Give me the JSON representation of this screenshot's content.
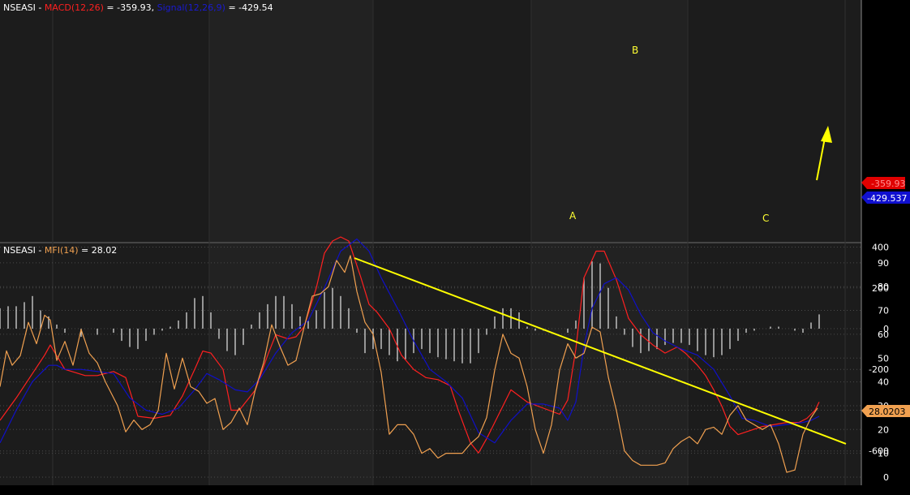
{
  "macd_panel": {
    "symbol": "NSEASI",
    "sep1": " - ",
    "macd_label": "MACD(12,26)",
    "macd_eq": " = -359.93, ",
    "signal_label": "Signal(12,26,9)",
    "signal_eq": " = -429.54",
    "badge_macd": "-359.93",
    "badge_signal": "-429.537",
    "annotations": [
      "A",
      "B",
      "C"
    ]
  },
  "mfi_panel": {
    "symbol": "NSEASI",
    "sep1": " - ",
    "mfi_label": "MFI(14)",
    "mfi_eq": " = 28.02",
    "badge_mfi": "28.0203"
  },
  "colors": {
    "background": "#000000",
    "panel": "#1c1c1c",
    "macd": "#ff2020",
    "signal": "#1010c8",
    "histogram": "#e6e6e6",
    "mfi": "#f0a050",
    "trendline": "#ffff00",
    "arrow": "#ffff00"
  },
  "chart_data": [
    {
      "type": "line",
      "ylim": [
        -650,
        450
      ],
      "yticks": [
        400,
        200,
        0,
        -200,
        -400,
        -600
      ],
      "xlim": [
        0,
        1060
      ],
      "series": [
        {
          "name": "MACD(12,26)",
          "color": "#ff2020",
          "x": [
            0,
            20,
            40,
            55,
            62,
            80,
            105,
            120,
            140,
            155,
            170,
            190,
            210,
            225,
            240,
            250,
            260,
            275,
            285,
            295,
            315,
            330,
            340,
            355,
            365,
            375,
            390,
            400,
            410,
            420,
            430,
            445,
            455,
            465,
            480,
            495,
            510,
            525,
            540,
            555,
            565,
            580,
            590,
            600,
            615,
            630,
            650,
            670,
            690,
            700,
            710,
            720,
            735,
            745,
            760,
            775,
            790,
            805,
            820,
            835,
            845,
            860,
            870,
            880,
            890,
            900,
            910,
            925,
            940,
            955,
            970,
            985,
            995,
            1000,
            1005,
            1010
          ],
          "y": [
            -450,
            -340,
            -220,
            -130,
            -80,
            -200,
            -230,
            -230,
            -210,
            -240,
            -430,
            -440,
            -425,
            -330,
            -200,
            -110,
            -120,
            -200,
            -400,
            -400,
            -300,
            -130,
            -30,
            -50,
            -40,
            10,
            200,
            370,
            430,
            450,
            430,
            250,
            120,
            80,
            0,
            -130,
            -200,
            -240,
            -250,
            -280,
            -400,
            -560,
            -610,
            -540,
            -420,
            -300,
            -360,
            -390,
            -420,
            -350,
            -100,
            250,
            380,
            380,
            240,
            50,
            -30,
            -80,
            -120,
            -90,
            -120,
            -180,
            -230,
            -300,
            -380,
            -480,
            -520,
            -500,
            -480,
            -470,
            -460,
            -460,
            -440,
            -420,
            -400,
            -360
          ]
        },
        {
          "name": "Signal(12,26,9)",
          "color": "#1010c8",
          "x": [
            0,
            20,
            40,
            60,
            70,
            80,
            100,
            120,
            140,
            160,
            180,
            200,
            220,
            240,
            255,
            270,
            290,
            305,
            320,
            340,
            360,
            380,
            400,
            420,
            440,
            455,
            470,
            490,
            510,
            530,
            550,
            570,
            590,
            610,
            630,
            650,
            670,
            690,
            700,
            710,
            720,
            730,
            745,
            760,
            775,
            790,
            805,
            820,
            840,
            860,
            880,
            900,
            915,
            930,
            950,
            970,
            990,
            1000,
            1010
          ],
          "y": [
            -560,
            -400,
            -260,
            -180,
            -180,
            -200,
            -200,
            -210,
            -220,
            -340,
            -400,
            -420,
            -390,
            -300,
            -220,
            -250,
            -300,
            -310,
            -250,
            -120,
            -20,
            40,
            200,
            380,
            440,
            380,
            250,
            100,
            -60,
            -200,
            -260,
            -340,
            -510,
            -560,
            -450,
            -370,
            -370,
            -390,
            -450,
            -360,
            -90,
            100,
            220,
            250,
            190,
            70,
            -20,
            -60,
            -100,
            -130,
            -200,
            -330,
            -440,
            -450,
            -480,
            -470,
            -460,
            -450,
            -430
          ]
        },
        {
          "name": "Histogram",
          "type": "bar",
          "color": "#e6e6e6",
          "x": [
            0,
            10,
            20,
            30,
            40,
            50,
            60,
            70,
            80,
            100,
            120,
            140,
            150,
            160,
            170,
            180,
            190,
            200,
            210,
            220,
            230,
            240,
            250,
            260,
            270,
            280,
            290,
            300,
            310,
            320,
            330,
            340,
            350,
            360,
            370,
            380,
            390,
            400,
            410,
            420,
            430,
            440,
            450,
            460,
            470,
            480,
            490,
            500,
            510,
            520,
            530,
            540,
            550,
            560,
            570,
            580,
            590,
            600,
            610,
            620,
            630,
            640,
            650,
            660,
            670,
            680,
            690,
            700,
            710,
            720,
            730,
            740,
            750,
            760,
            770,
            780,
            790,
            800,
            810,
            820,
            830,
            840,
            850,
            860,
            870,
            880,
            890,
            900,
            910,
            920,
            930,
            940,
            950,
            960,
            970,
            980,
            990,
            1000,
            1010
          ],
          "y": [
            100,
            110,
            110,
            130,
            160,
            90,
            60,
            20,
            -20,
            -40,
            -30,
            -20,
            -60,
            -90,
            -100,
            -60,
            -30,
            -10,
            10,
            40,
            80,
            150,
            160,
            80,
            -50,
            -110,
            -130,
            -80,
            20,
            80,
            120,
            160,
            160,
            120,
            60,
            40,
            90,
            180,
            200,
            160,
            100,
            -20,
            -120,
            -100,
            -100,
            -130,
            -160,
            -150,
            -120,
            -100,
            -120,
            -140,
            -150,
            -160,
            -170,
            -170,
            -120,
            -30,
            60,
            100,
            100,
            80,
            10,
            -10,
            -10,
            0,
            0,
            -20,
            40,
            250,
            330,
            320,
            200,
            60,
            -30,
            -90,
            -120,
            -110,
            -100,
            -80,
            -70,
            -70,
            -80,
            -110,
            -130,
            -140,
            -130,
            -100,
            -60,
            -20,
            -10,
            0,
            10,
            10,
            0,
            -10,
            -20,
            30,
            70
          ]
        }
      ]
    },
    {
      "type": "line",
      "ylim": [
        -3,
        97
      ],
      "yticks": [
        90,
        80,
        70,
        60,
        50,
        40,
        30,
        20,
        10,
        0
      ],
      "xlim": [
        0,
        1060
      ],
      "series": [
        {
          "name": "MFI(14)",
          "color": "#f0a050",
          "x": [
            0,
            8,
            15,
            25,
            35,
            45,
            55,
            62,
            70,
            80,
            90,
            100,
            110,
            120,
            130,
            145,
            155,
            165,
            175,
            185,
            195,
            205,
            215,
            225,
            235,
            245,
            255,
            265,
            275,
            285,
            295,
            305,
            315,
            325,
            335,
            345,
            355,
            365,
            375,
            385,
            395,
            405,
            415,
            425,
            432,
            440,
            450,
            460,
            470,
            480,
            490,
            500,
            510,
            520,
            530,
            540,
            550,
            560,
            570,
            580,
            590,
            600,
            610,
            620,
            630,
            640,
            650,
            660,
            670,
            680,
            690,
            700,
            710,
            720,
            730,
            740,
            750,
            760,
            770,
            780,
            790,
            800,
            810,
            820,
            830,
            840,
            850,
            860,
            870,
            880,
            890,
            900,
            910,
            920,
            930,
            940,
            950,
            960,
            970,
            980,
            990,
            1000,
            1008
          ],
          "y": [
            38,
            53,
            47,
            51,
            65,
            56,
            68,
            66,
            49,
            57,
            47,
            62,
            52,
            48,
            40,
            30,
            19,
            24,
            20,
            22,
            28,
            52,
            37,
            50,
            38,
            36,
            31,
            33,
            20,
            23,
            29,
            22,
            37,
            48,
            64,
            55,
            47,
            49,
            63,
            76,
            77,
            80,
            91,
            86,
            93,
            78,
            65,
            60,
            44,
            18,
            22,
            22,
            18,
            10,
            12,
            8,
            10,
            10,
            10,
            14,
            17,
            25,
            45,
            60,
            52,
            50,
            38,
            20,
            10,
            22,
            45,
            56,
            50,
            52,
            63,
            61,
            42,
            28,
            11,
            7,
            5,
            5,
            5,
            6,
            12,
            15,
            17,
            14,
            20,
            21,
            18,
            26,
            30,
            24,
            22,
            20,
            22,
            14,
            2,
            3,
            18,
            25,
            29
          ]
        },
        {
          "name": "trendline",
          "color": "#ffff00",
          "x": [
            437,
            1043
          ],
          "y": [
            92,
            14
          ]
        }
      ]
    }
  ]
}
